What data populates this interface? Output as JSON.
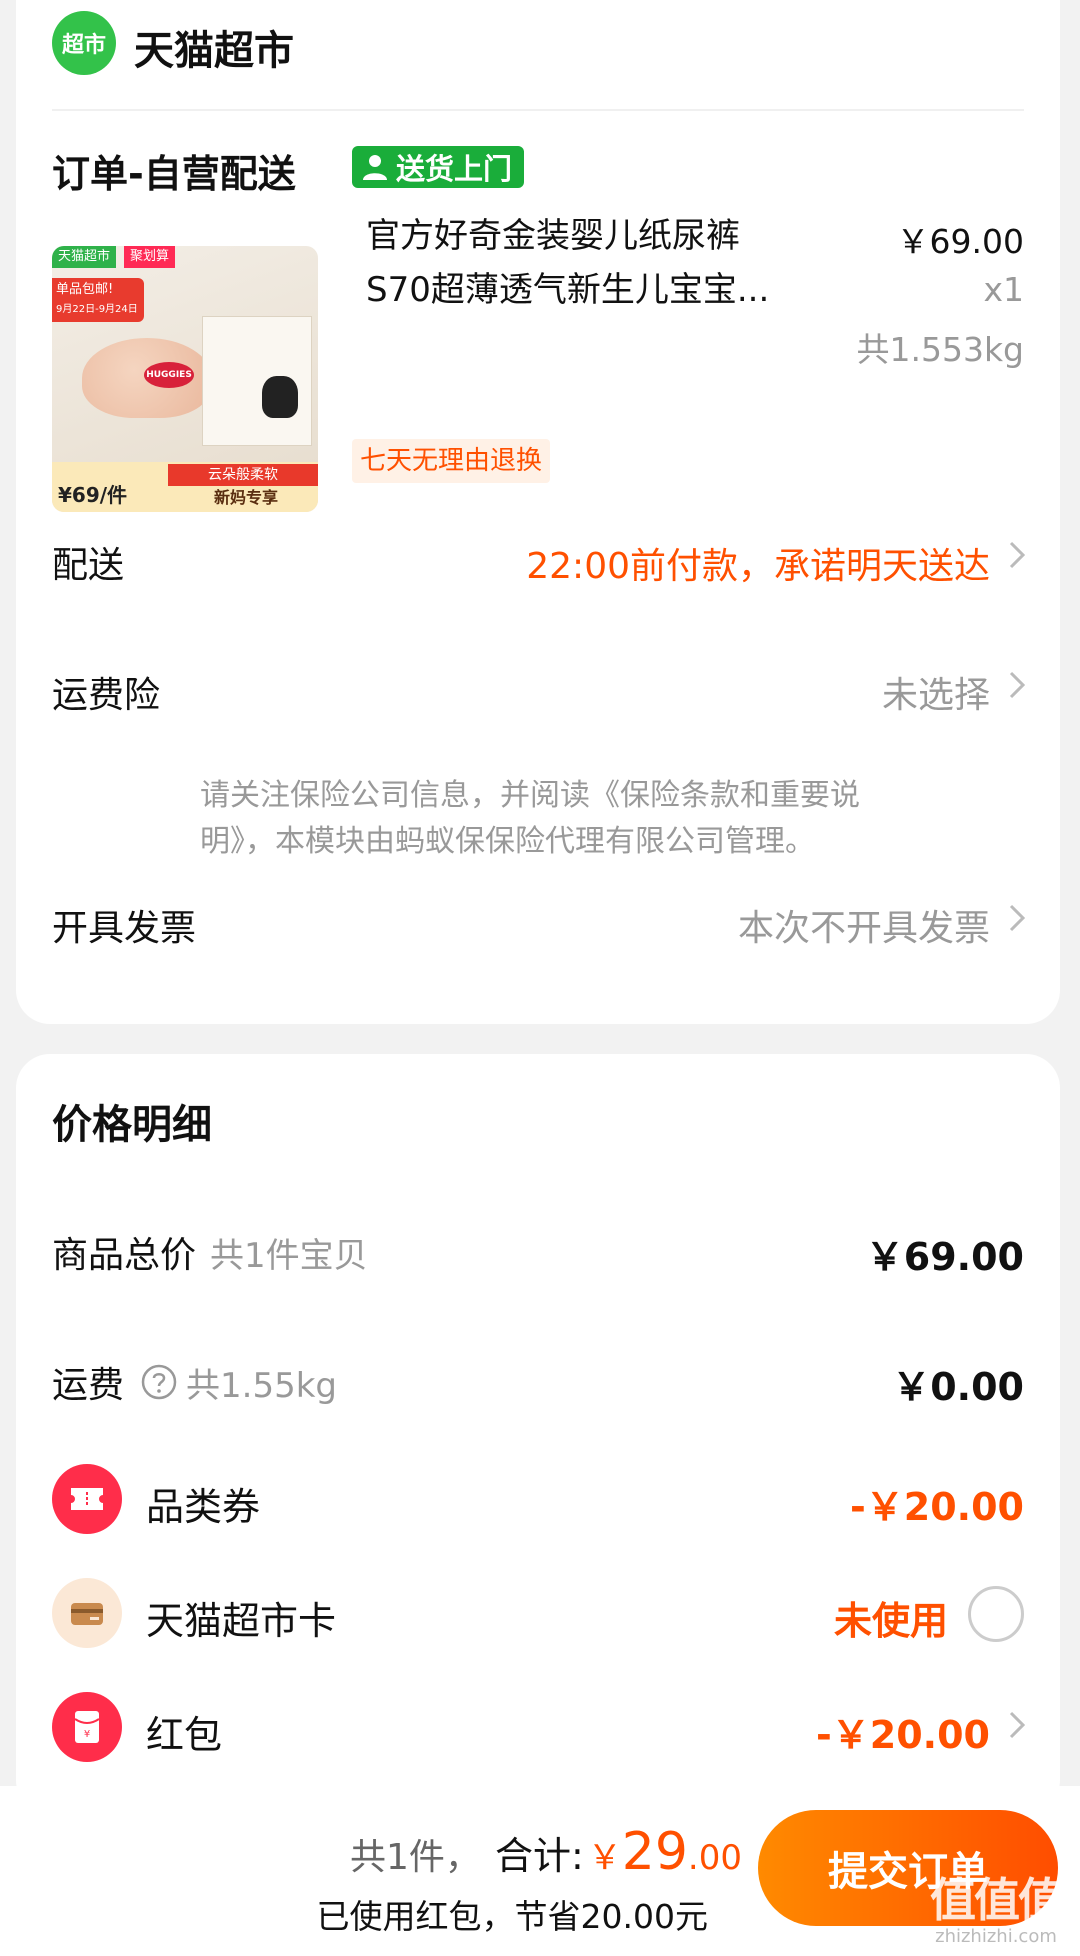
{
  "store": {
    "logo_text": "超市",
    "name": "天猫超市"
  },
  "order": {
    "title": "订单-自营配送",
    "delivery_tag": "送货上门"
  },
  "product": {
    "image": {
      "brand_tag": "天猫超市",
      "promo_tag": "聚划算",
      "red_line1": "单品包邮!",
      "red_line2": "9月22日-9月24日",
      "logo": "HUGGIES",
      "soft_label": "云朵般柔软",
      "price_label": "¥69/件",
      "newmom_label": "新妈专享"
    },
    "title_line1": "官方好奇金装婴儿纸尿裤",
    "title_line2": "S70超薄透气新生儿宝宝...",
    "price": "￥69.00",
    "qty": "x1",
    "weight": "共1.553kg",
    "return_tag": "七天无理由退换"
  },
  "delivery": {
    "label": "配送",
    "value": "22:00前付款，承诺明天送达"
  },
  "insurance": {
    "label": "运费险",
    "value": "未选择",
    "notice_line1": "请关注保险公司信息，并阅读《保险条款和重要说",
    "notice_line2": "明》，本模块由蚂蚁保保险代理有限公司管理。"
  },
  "invoice": {
    "label": "开具发票",
    "value": "本次不开具发票"
  },
  "price_detail": {
    "title": "价格明细",
    "goods_total": {
      "label": "商品总价",
      "sub": "共1件宝贝",
      "value": "￥69.00"
    },
    "shipping": {
      "label": "运费",
      "sub": "共1.55kg",
      "value": "￥0.00"
    },
    "coupon": {
      "label": "品类券",
      "value": "-￥20.00"
    },
    "market_card": {
      "label": "天猫超市卡",
      "value": "未使用"
    },
    "red_packet": {
      "label": "红包",
      "value": "-￥20.00"
    }
  },
  "footer": {
    "count": "共1件，",
    "total_label": "合计:",
    "currency": "￥",
    "total_int": "29",
    "total_dec": ".00",
    "saved": "已使用红包，节省20.00元",
    "submit": "提交订单",
    "watermark": "值值值",
    "watermark_sub": "zhizhizhi.com"
  },
  "colors": {
    "accent": "#ff5000",
    "brand_green": "#1aad3a",
    "muted": "#999999"
  }
}
